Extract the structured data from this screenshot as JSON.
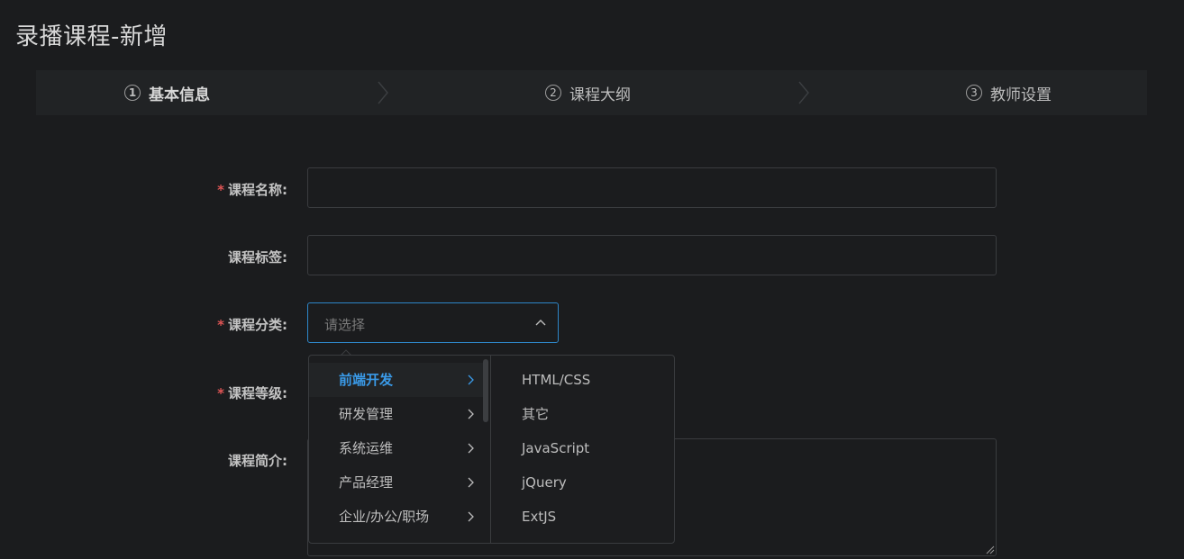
{
  "page": {
    "title": "录播课程-新增"
  },
  "steps": [
    {
      "num": "1",
      "label": "基本信息"
    },
    {
      "num": "2",
      "label": "课程大纲"
    },
    {
      "num": "3",
      "label": "教师设置"
    }
  ],
  "form": {
    "name_label": "课程名称:",
    "tag_label": "课程标签:",
    "category_label": "课程分类:",
    "level_label": "课程等级:",
    "intro_label": "课程简介:",
    "required_mark": "*",
    "category_placeholder": "请选择"
  },
  "cascader": {
    "level1": [
      "前端开发",
      "研发管理",
      "系统运维",
      "产品经理",
      "企业/办公/职场"
    ],
    "level2": [
      "HTML/CSS",
      "其它",
      "JavaScript",
      "jQuery",
      "ExtJS"
    ]
  },
  "colors": {
    "accent": "#3a9ae8",
    "required": "#e05555",
    "focus_border": "#2e86c8"
  }
}
